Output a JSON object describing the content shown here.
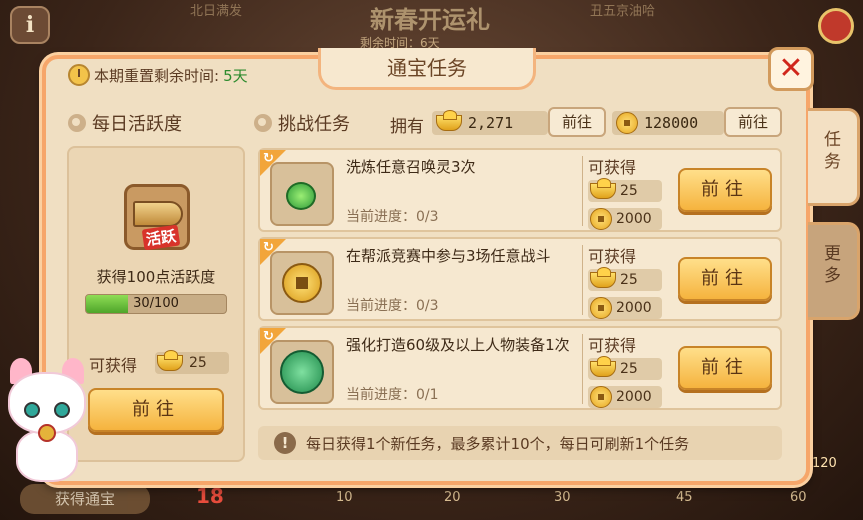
{
  "background": {
    "title": "新春开运礼",
    "left_label": "北日满发",
    "right_label": "丑五京油哈",
    "timer": "剩余时间：6天",
    "bottom_button": "获得通宝",
    "bottom_count": "18",
    "bottom_ticks": [
      "10",
      "20",
      "30",
      "45",
      "60"
    ],
    "right_count": "120"
  },
  "panel": {
    "title": "通宝任务",
    "reset_label": "本期重置剩余时间:",
    "reset_value": "5天"
  },
  "side_tabs": [
    {
      "label": "任务",
      "active": true
    },
    {
      "label": "更多",
      "active": false
    }
  ],
  "daily": {
    "heading": "每日活跃度",
    "badge": "活跃",
    "desc": "获得100点活跃度",
    "progress_text": "30/100",
    "progress_fraction": 0.3,
    "get_label": "可获得",
    "reward": "25",
    "go_label": "前往"
  },
  "challenge": {
    "heading": "挑战任务",
    "own_label": "拥有",
    "ingot_count": "2,271",
    "coin_count": "128000",
    "go_label": "前往"
  },
  "tasks": [
    {
      "name": "洗炼任意召唤灵3次",
      "progress": "当前进度：0/3",
      "get_label": "可获得",
      "ingot": "25",
      "coin": "2000",
      "go_label": "前往",
      "icon": "herb-icon"
    },
    {
      "name": "在帮派竞赛中参与3场任意战斗",
      "progress": "当前进度：0/3",
      "get_label": "可获得",
      "ingot": "25",
      "coin": "2000",
      "go_label": "前往",
      "icon": "gold-coin-icon"
    },
    {
      "name": "强化打造60级及以上人物装备1次",
      "progress": "当前进度：0/1",
      "get_label": "可获得",
      "ingot": "25",
      "coin": "2000",
      "go_label": "前往",
      "icon": "jade-disc-icon"
    }
  ],
  "notice": "每日获得1个新任务，最多累计10个，每日可刷新1个任务",
  "colors": {
    "accent": "#f5b33e",
    "panel_border": "#f6a66a",
    "close_red": "#d0261b",
    "progress_green": "#4ea52a"
  }
}
